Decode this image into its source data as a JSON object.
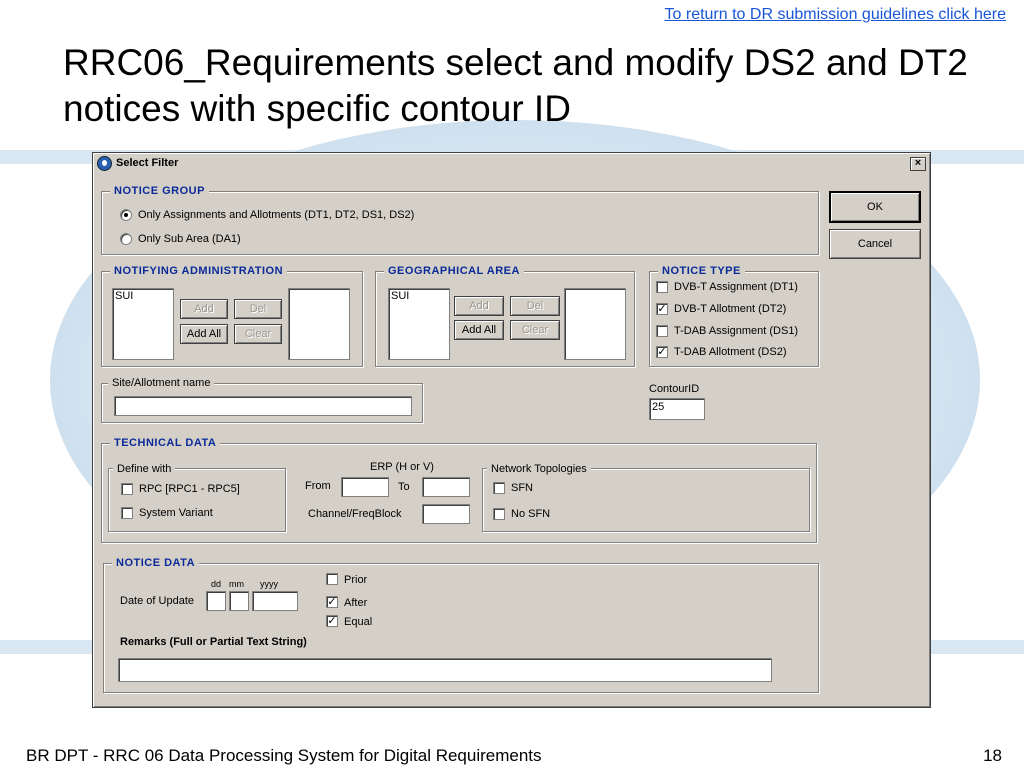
{
  "slide": {
    "top_link": "To return to DR submission guidelines click here",
    "title": "RRC06_Requirements select and modify DS2 and DT2 notices with specific contour ID",
    "footer_left": "BR DPT - RRC 06 Data Processing System for Digital Requirements",
    "footer_right": "18"
  },
  "dialog": {
    "title": "Select Filter",
    "close_label": "×",
    "ok_label": "OK",
    "cancel_label": "Cancel",
    "notice_group": {
      "legend": "NOTICE GROUP",
      "option_assignments": "Only Assignments and Allotments (DT1, DT2, DS1, DS2)",
      "option_sub_area": "Only Sub Area (DA1)"
    },
    "notifying_admin": {
      "legend": "NOTIFYING ADMINISTRATION",
      "list_value": "SUI",
      "add_label": "Add",
      "del_label": "Del",
      "add_all_label": "Add All",
      "clear_label": "Clear"
    },
    "geo_area": {
      "legend": "GEOGRAPHICAL AREA",
      "list_value": "SUI",
      "add_label": "Add",
      "del_label": "Del",
      "add_all_label": "Add All",
      "clear_label": "Clear"
    },
    "notice_type": {
      "legend": "NOTICE TYPE",
      "dt1": {
        "label": "DVB-T Assignment (DT1)",
        "mark": ""
      },
      "dt2": {
        "label": "DVB-T Allotment (DT2)",
        "mark": "✓"
      },
      "ds1": {
        "label": "T-DAB Assignment (DS1)",
        "mark": ""
      },
      "ds2": {
        "label": "T-DAB Allotment (DS2)",
        "mark": "✓"
      }
    },
    "site_allotment": {
      "legend": "Site/Allotment name",
      "value": ""
    },
    "contour": {
      "label": "ContourID",
      "value": "25"
    },
    "technical": {
      "legend": "TECHNICAL DATA",
      "define_with": "Define with",
      "rpc_label": "RPC [RPC1 - RPC5]",
      "system_variant_label": "System Variant",
      "erp_label": "ERP (H or V)",
      "from_label": "From",
      "to_label": "To",
      "channel_label": "Channel/FreqBlock",
      "network_topologies": "Network Topologies",
      "sfn_label": "SFN",
      "no_sfn_label": "No SFN"
    },
    "notice_data": {
      "legend": "NOTICE DATA",
      "dd": "dd",
      "mm": "mm",
      "yyyy": "yyyy",
      "date_label": "Date of Update",
      "prior": {
        "label": "Prior",
        "mark": ""
      },
      "after": {
        "label": "After",
        "mark": "✓"
      },
      "equal": {
        "label": "Equal",
        "mark": "✓"
      },
      "remarks_label": "Remarks (Full or Partial Text String)",
      "remarks_value": ""
    }
  }
}
